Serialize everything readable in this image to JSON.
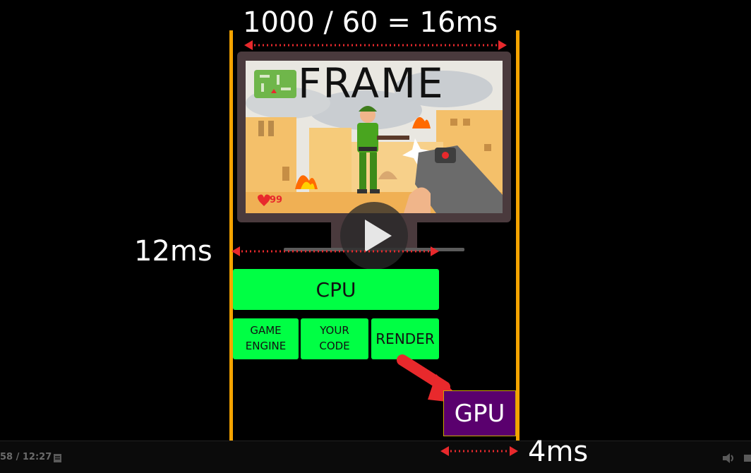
{
  "labels": {
    "frame_time": "1000 / 60 = 16ms",
    "cpu_time": "12ms",
    "gpu_time": "4ms",
    "frame": "FRAME"
  },
  "boxes": {
    "cpu": "CPU",
    "game_engine": "GAME\nENGINE",
    "your_code": "YOUR\nCODE",
    "render": "RENDER",
    "gpu": "GPU"
  },
  "game_hud": {
    "health": "99"
  },
  "player": {
    "time": "58 / 12:27"
  },
  "colors": {
    "cpu_green": "#00ff44",
    "gpu_purple": "#5a006e",
    "guide_orange": "#f5a300",
    "arrow_red": "#e8292c"
  }
}
